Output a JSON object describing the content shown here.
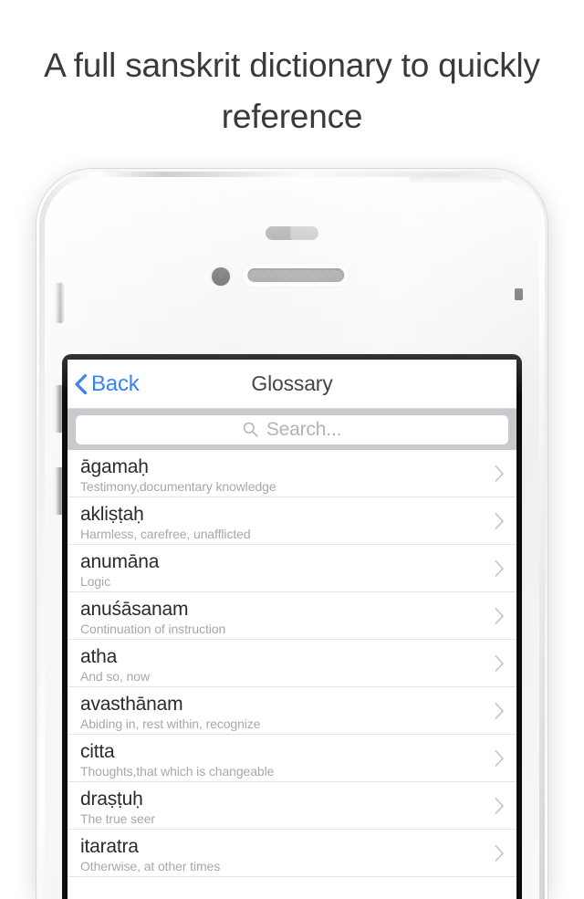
{
  "headline": "A full sanskrit dictionary to quickly reference",
  "colors": {
    "accent_blue": "#2f7cf6",
    "page_background": "#ffffff",
    "searchbar_background": "#c9c9ce",
    "term_text": "#2b2b2b",
    "definition_text": "#a8a8a8",
    "chevron": "#c9c9c9"
  },
  "device": {
    "hardware": {
      "power_button": "power-button",
      "mute_switch": "mute-switch",
      "volume_up": "volume-up-button",
      "volume_down": "volume-down-button",
      "front_camera": "front-camera",
      "earpiece_speaker": "earpiece-speaker",
      "proximity_sensor": "proximity-sensor",
      "antenna_band": "antenna-band"
    }
  },
  "navbar": {
    "back_label": "Back",
    "title": "Glossary"
  },
  "search": {
    "placeholder": "Search...",
    "value": "",
    "icon": "search-icon"
  },
  "list": {
    "rows": [
      {
        "term": "āgamaḥ",
        "definition": "Testimony,documentary knowledge"
      },
      {
        "term": "akliṣṭaḥ",
        "definition": "Harmless, carefree, unafflicted"
      },
      {
        "term": "anumāna",
        "definition": "Logic"
      },
      {
        "term": "anuśāsanam",
        "definition": "Continuation of instruction"
      },
      {
        "term": "atha",
        "definition": "And so, now"
      },
      {
        "term": "avasthānam",
        "definition": "Abiding in, rest within, recognize"
      },
      {
        "term": "citta",
        "definition": "Thoughts,that which is changeable"
      },
      {
        "term": "draṣṭuḥ",
        "definition": "The true seer"
      },
      {
        "term": "itaratra",
        "definition": "Otherwise, at other times"
      }
    ]
  }
}
